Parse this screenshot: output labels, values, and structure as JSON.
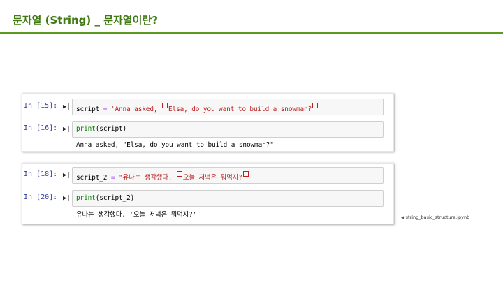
{
  "slide": {
    "title": "문자열 (String) _ 문자열이란?",
    "accent_color": "#3f7a12"
  },
  "notebook": {
    "group1": {
      "cell1": {
        "prompt": "In [15]:",
        "var": "script",
        "op": " = ",
        "str_a": "'Anna asked, ",
        "str_b": "Elsa, do you want to build a snowman?"
      },
      "cell2": {
        "prompt": "In [16]:",
        "func": "print",
        "args": "(script)",
        "output": "Anna asked, \"Elsa, do you want to build a snowman?\""
      }
    },
    "group2": {
      "cell1": {
        "prompt": "In [18]:",
        "var": "script_2",
        "op": " = ",
        "str_a": "\"유나는 생각했다. ",
        "str_b": "오늘 저녁은 뭐먹지?"
      },
      "cell2": {
        "prompt": "In [20]:",
        "func": "print",
        "args": "(script_2)",
        "output": "유나는 생각했다. '오늘 저녁은 뭐먹지?'"
      }
    }
  },
  "run_icon": "run-cell-icon",
  "filename": "string_basic_structure.ipynb"
}
